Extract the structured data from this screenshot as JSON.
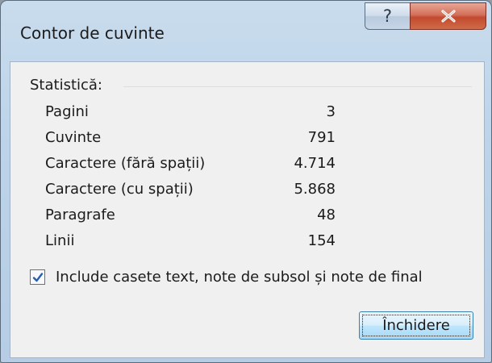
{
  "window": {
    "title": "Contor de cuvinte"
  },
  "caption": {
    "help_glyph": "?",
    "close_glyph": "x",
    "help_icon": "question-mark-icon",
    "close_icon": "close-x-icon"
  },
  "statistics": {
    "group_label": "Statistică:",
    "rows": [
      {
        "name": "Pagini",
        "value": "3"
      },
      {
        "name": "Cuvinte",
        "value": "791"
      },
      {
        "name": "Caractere (fără spații)",
        "value": "4.714"
      },
      {
        "name": "Caractere (cu spații)",
        "value": "5.868"
      },
      {
        "name": "Paragrafe",
        "value": "48"
      },
      {
        "name": "Linii",
        "value": "154"
      }
    ]
  },
  "include_checkbox": {
    "checked": true,
    "label": "Include casete text, note de subsol și note de final"
  },
  "close_button": {
    "label": "Închidere"
  },
  "colors": {
    "accent": "#3c7fb1",
    "close_red": "#c24a2e"
  }
}
